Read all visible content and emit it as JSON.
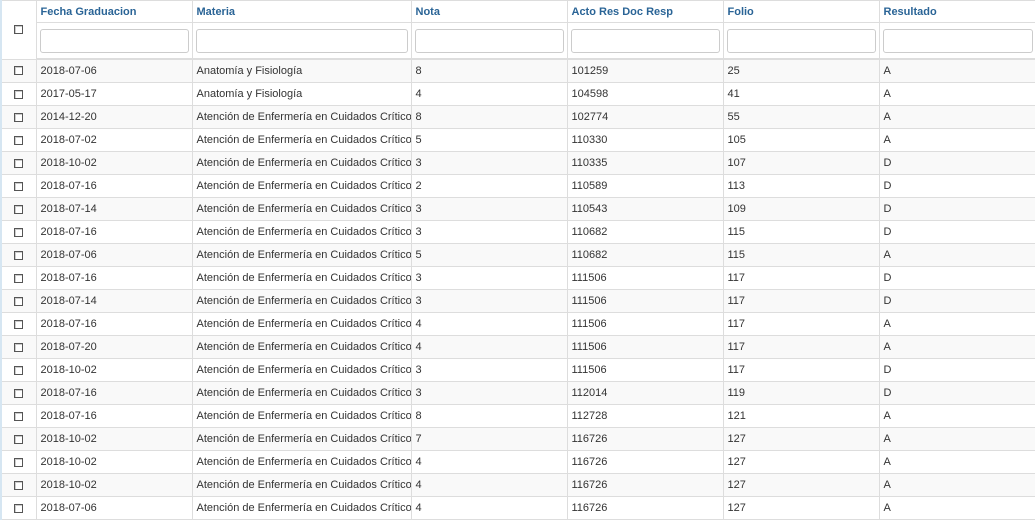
{
  "columns": [
    "Fecha Graduacion",
    "Materia",
    "Nota",
    "Acto Res Doc Resp",
    "Folio",
    "Resultado"
  ],
  "filters": [
    "",
    "",
    "",
    "",
    "",
    ""
  ],
  "rows": [
    [
      "2018-07-06",
      "Anatomía y Fisiología",
      "8",
      "101259",
      "25",
      "A"
    ],
    [
      "2017-05-17",
      "Anatomía y Fisiología",
      "4",
      "104598",
      "41",
      "A"
    ],
    [
      "2014-12-20",
      "Atención de Enfermería en Cuidados Críticos",
      "8",
      "102774",
      "55",
      "A"
    ],
    [
      "2018-07-02",
      "Atención de Enfermería en Cuidados Críticos",
      "5",
      "110330",
      "105",
      "A"
    ],
    [
      "2018-10-02",
      "Atención de Enfermería en Cuidados Críticos",
      "3",
      "110335",
      "107",
      "D"
    ],
    [
      "2018-07-16",
      "Atención de Enfermería en Cuidados Críticos",
      "2",
      "110589",
      "113",
      "D"
    ],
    [
      "2018-07-14",
      "Atención de Enfermería en Cuidados Críticos",
      "3",
      "110543",
      "109",
      "D"
    ],
    [
      "2018-07-16",
      "Atención de Enfermería en Cuidados Críticos",
      "3",
      "110682",
      "115",
      "D"
    ],
    [
      "2018-07-06",
      "Atención de Enfermería en Cuidados Críticos",
      "5",
      "110682",
      "115",
      "A"
    ],
    [
      "2018-07-16",
      "Atención de Enfermería en Cuidados Críticos",
      "3",
      "111506",
      "117",
      "D"
    ],
    [
      "2018-07-14",
      "Atención de Enfermería en Cuidados Críticos",
      "3",
      "111506",
      "117",
      "D"
    ],
    [
      "2018-07-16",
      "Atención de Enfermería en Cuidados Críticos",
      "4",
      "111506",
      "117",
      "A"
    ],
    [
      "2018-07-20",
      "Atención de Enfermería en Cuidados Críticos",
      "4",
      "111506",
      "117",
      "A"
    ],
    [
      "2018-10-02",
      "Atención de Enfermería en Cuidados Críticos",
      "3",
      "111506",
      "117",
      "D"
    ],
    [
      "2018-07-16",
      "Atención de Enfermería en Cuidados Críticos",
      "3",
      "112014",
      "119",
      "D"
    ],
    [
      "2018-07-16",
      "Atención de Enfermería en Cuidados Críticos",
      "8",
      "112728",
      "121",
      "A"
    ],
    [
      "2018-10-02",
      "Atención de Enfermería en Cuidados Críticos",
      "7",
      "116726",
      "127",
      "A"
    ],
    [
      "2018-10-02",
      "Atención de Enfermería en Cuidados Críticos",
      "4",
      "116726",
      "127",
      "A"
    ],
    [
      "2018-10-02",
      "Atención de Enfermería en Cuidados Críticos",
      "4",
      "116726",
      "127",
      "A"
    ],
    [
      "2018-07-06",
      "Atención de Enfermería en Cuidados Críticos",
      "4",
      "116726",
      "127",
      "A"
    ]
  ],
  "colors": {
    "header_text": "#2a6496",
    "row_stripe": "#f9f9f9",
    "border": "#dddddd"
  }
}
